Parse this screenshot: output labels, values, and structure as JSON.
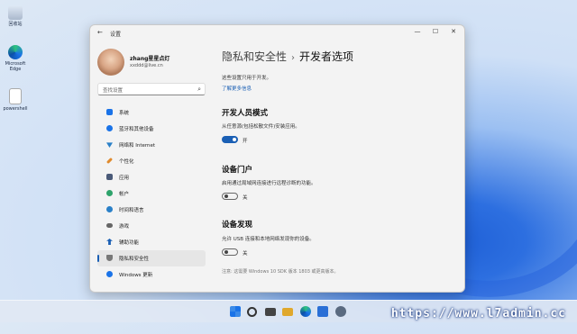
{
  "desktop": {
    "icons": [
      {
        "label": "回收站",
        "icon": "recycle-bin-icon"
      },
      {
        "label": "Microsoft Edge",
        "icon": "edge-icon"
      },
      {
        "label": "powershell",
        "icon": "file-icon"
      }
    ]
  },
  "window": {
    "title": "设置",
    "back": "←",
    "controls": {
      "minimize": "—",
      "maximize": "☐",
      "close": "✕"
    }
  },
  "user": {
    "name": "zhang星星点灯",
    "email": "xxddd@live.cn"
  },
  "search": {
    "placeholder": "查找设置"
  },
  "sidebar": {
    "items": [
      {
        "label": "系统",
        "icon": "system-icon",
        "color": "#1a73e8"
      },
      {
        "label": "蓝牙和其他设备",
        "icon": "bluetooth-icon",
        "color": "#1a73e8"
      },
      {
        "label": "网络和 Internet",
        "icon": "network-icon",
        "color": "#2a80c8"
      },
      {
        "label": "个性化",
        "icon": "brush-icon",
        "color": "#e08a2c"
      },
      {
        "label": "应用",
        "icon": "apps-icon",
        "color": "#4a5a78"
      },
      {
        "label": "帐户",
        "icon": "account-icon",
        "color": "#2ea36b"
      },
      {
        "label": "时间和语言",
        "icon": "clock-icon",
        "color": "#2a80c8"
      },
      {
        "label": "游戏",
        "icon": "game-icon",
        "color": "#666666"
      },
      {
        "label": "辅助功能",
        "icon": "accessibility-icon",
        "color": "#1a5fb4"
      },
      {
        "label": "隐私和安全性",
        "icon": "shield-icon",
        "color": "#777777",
        "active": true
      },
      {
        "label": "Windows 更新",
        "icon": "update-icon",
        "color": "#1a73e8"
      }
    ]
  },
  "content": {
    "breadcrumb_parent": "隐私和安全性",
    "breadcrumb_sep": "›",
    "breadcrumb_current": "开发者选项",
    "intro": "这些设置只用于开发。",
    "learn_more": "了解更多信息",
    "dev_mode": {
      "title": "开发人员模式",
      "desc": "从任意源(包括松散文件)安装应用。",
      "toggle": "开",
      "on": true
    },
    "device_portal": {
      "title": "设备门户",
      "desc": "启用通过局域网连接进行远程诊断的功能。",
      "toggle": "关",
      "on": false
    },
    "device_discovery": {
      "title": "设备发现",
      "desc": "允许 USB 连接和本地网络发现你的设备。",
      "toggle": "关",
      "on": false
    },
    "note": "注意: 这需要 Windows 10 SDK 版本 1803 或更高版本。"
  },
  "watermark": "https://www.l7admin.cc",
  "accent": "#1a5fb4"
}
